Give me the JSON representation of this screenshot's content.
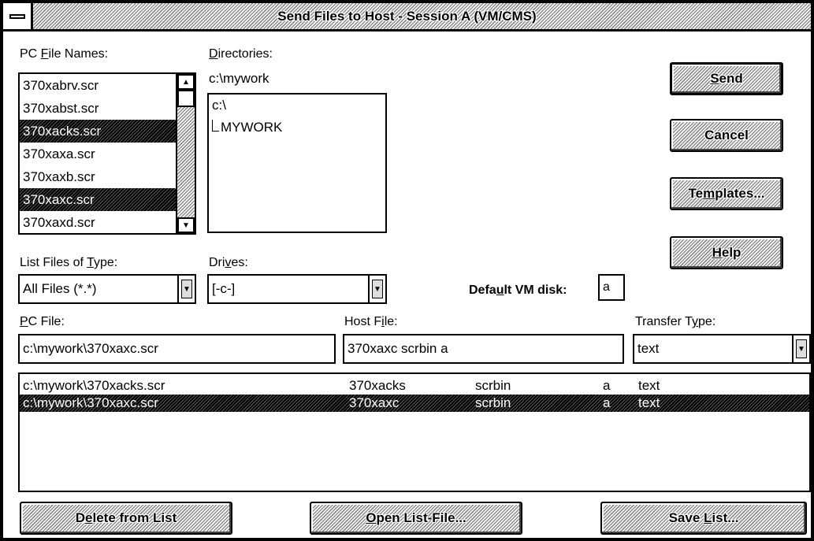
{
  "title": "Send Files to Host - Session A (VM/CMS)",
  "pc_file_names": {
    "label": "PC File Names:",
    "items": [
      {
        "name": "370xabrv.scr",
        "selected": false
      },
      {
        "name": "370xabst.scr",
        "selected": false
      },
      {
        "name": "370xacks.scr",
        "selected": true
      },
      {
        "name": "370xaxa.scr",
        "selected": false
      },
      {
        "name": "370xaxb.scr",
        "selected": false
      },
      {
        "name": "370xaxc.scr",
        "selected": true
      },
      {
        "name": "370xaxd.scr",
        "selected": false
      }
    ]
  },
  "directories": {
    "label": "Directories:",
    "current": "c:\\mywork",
    "items": [
      "c:\\",
      "MYWORK"
    ]
  },
  "buttons": {
    "send": "Send",
    "cancel": "Cancel",
    "templates": "Templates...",
    "help": "Help",
    "delete": "Delete from List",
    "open_list": "Open List-File...",
    "save_list": "Save List..."
  },
  "list_files_type": {
    "label": "List Files of Type:",
    "value": "All Files (*.*)"
  },
  "drives": {
    "label": "Drives:",
    "value": "[-c-]"
  },
  "default_vm_disk": {
    "label": "Default VM disk:",
    "value": "a"
  },
  "pc_file": {
    "label": "PC File:",
    "value": "c:\\mywork\\370xaxc.scr"
  },
  "host_file": {
    "label": "Host File:",
    "value": "370xaxc scrbin a"
  },
  "transfer_type": {
    "label": "Transfer Type:",
    "value": "text"
  },
  "transfer_list": [
    {
      "pc": "c:\\mywork\\370xacks.scr",
      "fn": "370xacks",
      "ft": "scrbin",
      "fm": "a",
      "type": "text",
      "selected": false
    },
    {
      "pc": "c:\\mywork\\370xaxc.scr",
      "fn": "370xaxc",
      "ft": "scrbin",
      "fm": "a",
      "type": "text",
      "selected": true
    }
  ]
}
